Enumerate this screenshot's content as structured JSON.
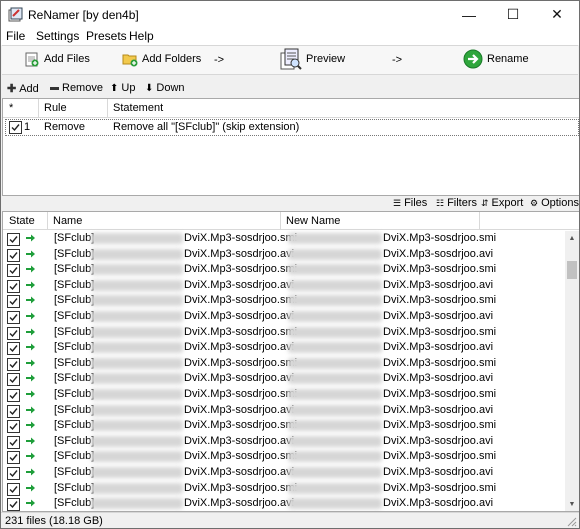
{
  "window": {
    "title": "ReNamer  [by den4b]",
    "controls": {
      "minimize": "—",
      "maximize": "☐",
      "close": "✕"
    }
  },
  "menu": {
    "items": [
      "File",
      "Settings",
      "Presets",
      "Help"
    ]
  },
  "toolbar": {
    "add_files": "Add Files",
    "add_folders": "Add Folders",
    "arrow1": "->",
    "preview": "Preview",
    "arrow2": "->",
    "rename": "Rename"
  },
  "rules_toolbar": {
    "add": "Add",
    "remove": "Remove",
    "up": "Up",
    "down": "Down"
  },
  "rules_table": {
    "headers": {
      "index": "*",
      "rule": "Rule",
      "statement": "Statement"
    },
    "rows": [
      {
        "index": "1",
        "checked": true,
        "rule": "Remove",
        "statement": "Remove all \"[SFclub]\" (skip extension)"
      }
    ]
  },
  "files_toolbar": {
    "files": "Files",
    "filters": "Filters",
    "export": "Export",
    "options": "Options"
  },
  "files_table": {
    "headers": {
      "state": "State",
      "name": "Name",
      "new_name": "New Name"
    },
    "rows": [
      {
        "name_prefix": "[SFclub]",
        "name_suffix": "DviX.Mp3-sosdrjoo.smi",
        "new_name_suffix": "DviX.Mp3-sosdrjoo.smi"
      },
      {
        "name_prefix": "[SFclub]",
        "name_suffix": "DviX.Mp3-sosdrjoo.avi",
        "new_name_suffix": "DviX.Mp3-sosdrjoo.avi"
      },
      {
        "name_prefix": "[SFclub]",
        "name_suffix": "DviX.Mp3-sosdrjoo.smi",
        "new_name_suffix": "DviX.Mp3-sosdrjoo.smi"
      },
      {
        "name_prefix": "[SFclub]",
        "name_suffix": "DviX.Mp3-sosdrjoo.avi",
        "new_name_suffix": "DviX.Mp3-sosdrjoo.avi"
      },
      {
        "name_prefix": "[SFclub]",
        "name_suffix": "DviX.Mp3-sosdrjoo.smi",
        "new_name_suffix": "DviX.Mp3-sosdrjoo.smi"
      },
      {
        "name_prefix": "[SFclub]",
        "name_suffix": "DviX.Mp3-sosdrjoo.avi",
        "new_name_suffix": "DviX.Mp3-sosdrjoo.avi"
      },
      {
        "name_prefix": "[SFclub]",
        "name_suffix": "DviX.Mp3-sosdrjoo.smi",
        "new_name_suffix": "DviX.Mp3-sosdrjoo.smi"
      },
      {
        "name_prefix": "[SFclub]",
        "name_suffix": "DviX.Mp3-sosdrjoo.avi",
        "new_name_suffix": "DviX.Mp3-sosdrjoo.avi"
      },
      {
        "name_prefix": "[SFclub]",
        "name_suffix": "DviX.Mp3-sosdrjoo.smi",
        "new_name_suffix": "DviX.Mp3-sosdrjoo.smi"
      },
      {
        "name_prefix": "[SFclub]",
        "name_suffix": "DviX.Mp3-sosdrjoo.avi",
        "new_name_suffix": "DviX.Mp3-sosdrjoo.avi"
      },
      {
        "name_prefix": "[SFclub]",
        "name_suffix": "DviX.Mp3-sosdrjoo.smi",
        "new_name_suffix": "DviX.Mp3-sosdrjoo.smi"
      },
      {
        "name_prefix": "[SFclub]",
        "name_suffix": "DviX.Mp3-sosdrjoo.avi",
        "new_name_suffix": "DviX.Mp3-sosdrjoo.avi"
      },
      {
        "name_prefix": "[SFclub]",
        "name_suffix": "DviX.Mp3-sosdrjoo.smi",
        "new_name_suffix": "DviX.Mp3-sosdrjoo.smi"
      },
      {
        "name_prefix": "[SFclub]",
        "name_suffix": "DviX.Mp3-sosdrjoo.avi",
        "new_name_suffix": "DviX.Mp3-sosdrjoo.avi"
      },
      {
        "name_prefix": "[SFclub]",
        "name_suffix": "DviX.Mp3-sosdrjoo.smi",
        "new_name_suffix": "DviX.Mp3-sosdrjoo.smi"
      },
      {
        "name_prefix": "[SFclub]",
        "name_suffix": "DviX.Mp3-sosdrjoo.avi",
        "new_name_suffix": "DviX.Mp3-sosdrjoo.avi"
      },
      {
        "name_prefix": "[SFclub]",
        "name_suffix": "DviX.Mp3-sosdrjoo.smi",
        "new_name_suffix": "DviX.Mp3-sosdrjoo.smi"
      },
      {
        "name_prefix": "[SFclub]",
        "name_suffix": "DviX.Mp3-sosdrjoo.avi",
        "new_name_suffix": "DviX.Mp3-sosdrjoo.avi"
      }
    ]
  },
  "status": {
    "text": "231 files (18.18 GB)"
  },
  "colors": {
    "accent_green": "#1e9e3a",
    "rename_green": "#2fa63c"
  }
}
